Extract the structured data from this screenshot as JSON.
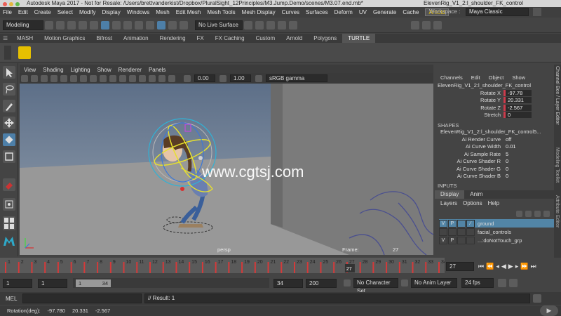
{
  "window": {
    "app_title": "Autodesk Maya 2017 - Not for Resale: /Users/brettvanderkist/Dropbox/PluralSight_12Principles/M3.Jump.Demo/scenes/M3.07.end.mb*",
    "selection_title": "ElevenRig_V1_2:l_shoulder_FK_control"
  },
  "menubar": {
    "items": [
      "File",
      "Edit",
      "Create",
      "Select",
      "Modify",
      "Display",
      "Windows",
      "Mesh",
      "Edit Mesh",
      "Mesh Tools",
      "Mesh Display",
      "Curves",
      "Surfaces",
      "Deform",
      "UV",
      "Generate",
      "Cache"
    ],
    "arnold_chip": "Arnold",
    "workspace_label": "Workspace :",
    "workspace_value": "Maya Classic"
  },
  "statusline": {
    "menuset": "Modeling",
    "live_surface": "No Live Surface"
  },
  "shelf": {
    "tabs": [
      "MASH",
      "Motion Graphics",
      "Bifrost",
      "Animation",
      "Rendering",
      "FX",
      "FX Caching",
      "Custom",
      "Arnold",
      "Polygons",
      "TURTLE"
    ],
    "active_tab": "TURTLE"
  },
  "viewport": {
    "menus": [
      "View",
      "Shading",
      "Lighting",
      "Show",
      "Renderer",
      "Panels"
    ],
    "exposure": "0.00",
    "gamma": "1.00",
    "color_space": "sRGB gamma",
    "camera": "persp",
    "frame_label": "Frame:",
    "frame_value": "27",
    "watermark": "www.cgtsj.com"
  },
  "channels": {
    "tabs": [
      "Channels",
      "Edit",
      "Object",
      "Show"
    ],
    "object": "ElevenRig_V1_2:l_shoulder_FK_control",
    "attrs": [
      {
        "label": "Rotate X",
        "value": "-97.78"
      },
      {
        "label": "Rotate Y",
        "value": "20.331"
      },
      {
        "label": "Rotate Z",
        "value": "-2.567"
      },
      {
        "label": "Stretch",
        "value": "0"
      }
    ],
    "shapes_header": "SHAPES",
    "shape_name": "ElevenRig_V1_2:l_shoulder_FK_control5...",
    "shape_attrs": [
      {
        "label": "Ai Render Curve",
        "value": "off"
      },
      {
        "label": "Ai Curve Width",
        "value": "0.01"
      },
      {
        "label": "Ai Sample Rate",
        "value": "5"
      },
      {
        "label": "Ai Curve Shader R",
        "value": "0"
      },
      {
        "label": "Ai Curve Shader G",
        "value": "0"
      },
      {
        "label": "Ai Curve Shader B",
        "value": "0"
      }
    ],
    "inputs_header": "INPUTS"
  },
  "layers": {
    "tabs": [
      "Display",
      "Anim"
    ],
    "menus": [
      "Layers",
      "Options",
      "Help"
    ],
    "rows": [
      {
        "v": "V",
        "p": "P",
        "name": "ground"
      },
      {
        "v": "",
        "p": "",
        "name": "facial_controls"
      },
      {
        "v": "V",
        "p": "P",
        "name": "...:doNotTouch_grp"
      }
    ]
  },
  "side_tabs": [
    "Channel Box / Layer Editor",
    "Modeling Toolkit",
    "Attribute Editor"
  ],
  "timeline": {
    "ticks": [
      "1",
      "2",
      "3",
      "4",
      "5",
      "6",
      "7",
      "8",
      "9",
      "10",
      "11",
      "12",
      "13",
      "14",
      "15",
      "16",
      "17",
      "18",
      "19",
      "20",
      "21",
      "22",
      "23",
      "24",
      "25",
      "26",
      "27",
      "28",
      "29",
      "30",
      "31",
      "32",
      "33",
      "34"
    ],
    "current": "27",
    "current_field": "27"
  },
  "range": {
    "start": "1",
    "playback_start": "1",
    "slider_start": "1",
    "slider_end": "34",
    "playback_end": "34",
    "end": "200",
    "character_set": "No Character Set",
    "anim_layer": "No Anim Layer",
    "fps": "24 fps"
  },
  "cmdline": {
    "label": "MEL",
    "result": "// Result: 1"
  },
  "helpline": {
    "label": "Rotation(deg):",
    "x": "-97.780",
    "y": "20.331",
    "z": "-2.567"
  }
}
